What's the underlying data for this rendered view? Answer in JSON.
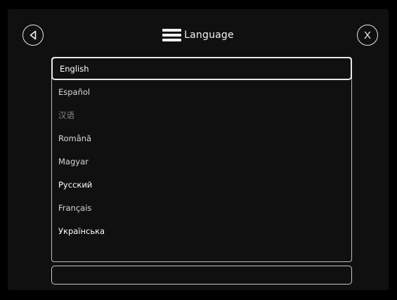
{
  "header": {
    "title": "Language",
    "back_icon": "triangle-left-in-circle",
    "menu_icon": "hamburger-menu",
    "close_label": "X"
  },
  "languages": [
    {
      "label": "English",
      "selected": true
    },
    {
      "label": "Español",
      "selected": false
    },
    {
      "label": "汉语",
      "selected": false
    },
    {
      "label": "Română",
      "selected": false
    },
    {
      "label": "Magyar",
      "selected": false
    },
    {
      "label": "Русский",
      "selected": false
    },
    {
      "label": "Français",
      "selected": false
    },
    {
      "label": "Українська",
      "selected": false
    }
  ],
  "footer": {
    "value": ""
  },
  "colors": {
    "background": "#000000",
    "panel": "#101010",
    "border": "#bdbdbd",
    "text": "#d8d8d8"
  }
}
